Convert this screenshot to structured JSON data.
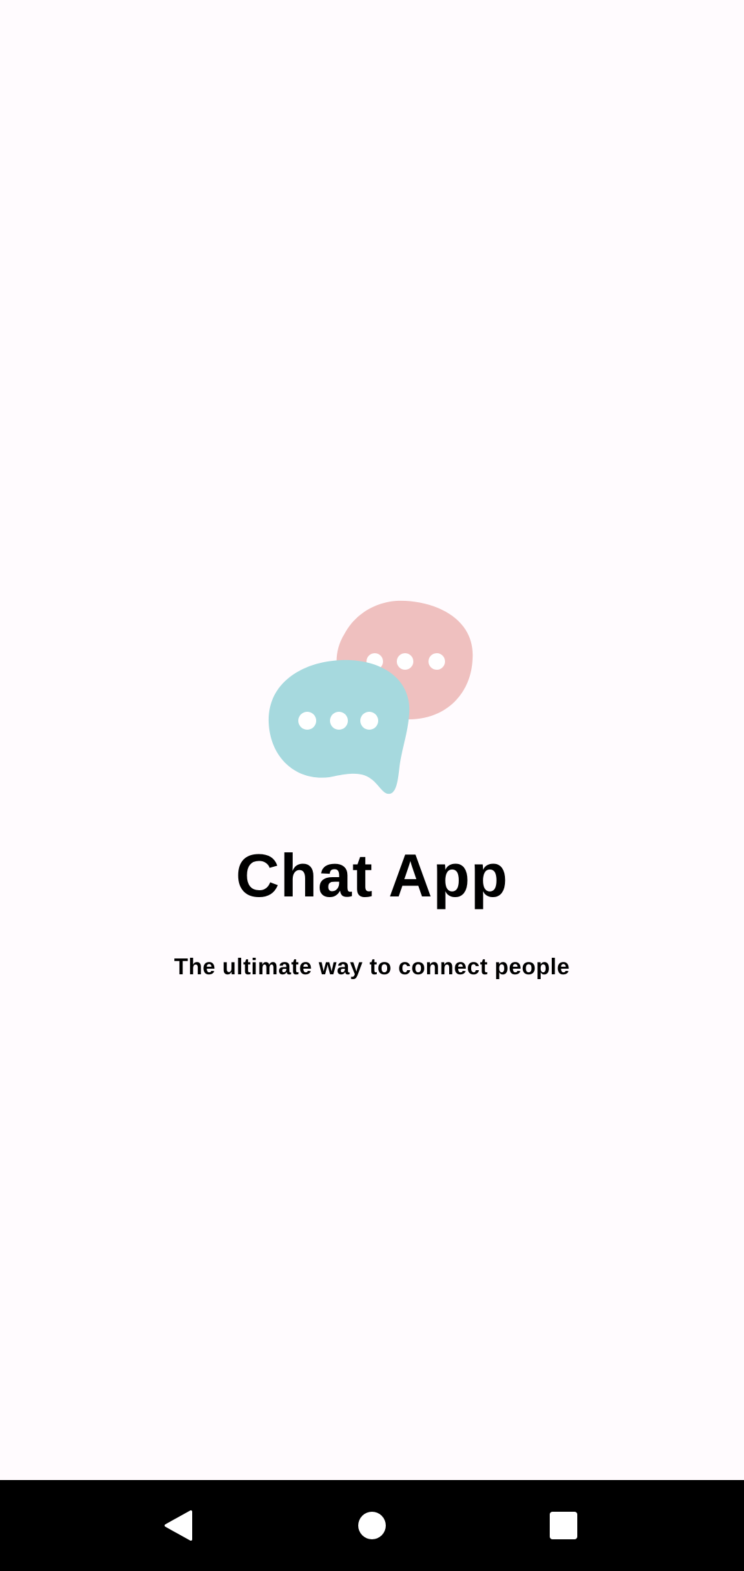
{
  "app": {
    "title": "Chat App",
    "tagline": "The ultimate way to connect people"
  },
  "logo": {
    "back_bubble_color": "#EFC0BF",
    "front_bubble_color": "#A6D9DE",
    "dots_color": "#FFFFFF",
    "icon": "chat-bubbles-icon"
  },
  "system_nav": {
    "back_icon": "back-triangle-icon",
    "home_icon": "home-circle-icon",
    "recents_icon": "recents-square-icon",
    "background": "#000000"
  },
  "colors": {
    "background": "#FFFBFE",
    "text": "#000000"
  }
}
